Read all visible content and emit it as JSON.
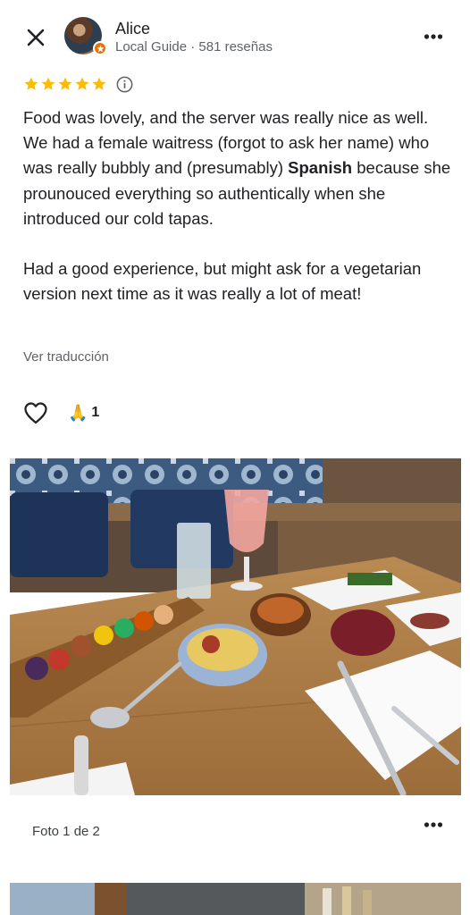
{
  "header": {
    "close_icon": "close-icon",
    "user_name": "Alice",
    "user_meta": "Local Guide · 581 reseñas",
    "more_icon": "more-vert-icon"
  },
  "review": {
    "rating": 5,
    "max_rating": 5,
    "star_color": "#fbbc04",
    "paragraph1_part1": "Food was lovely, and the server was really nice as well. We had a female waitress (forgot to ask her name) who was really bubbly and (presumably) ",
    "paragraph1_bold": "Spanish",
    "paragraph1_part2": " because she prounouced everything so authentically when she introduced our cold tapas.",
    "paragraph2": "Had a good experience, but might ask for a vegetarian version next time as it was really a lot of meat!",
    "translate_label": "Ver traducción"
  },
  "actions": {
    "like_icon": "heart-outline-icon",
    "reaction_emoji": "🙏",
    "reaction_count": "1"
  },
  "photo": {
    "caption": "Foto 1 de 2",
    "more_icon": "more-vert-icon"
  }
}
